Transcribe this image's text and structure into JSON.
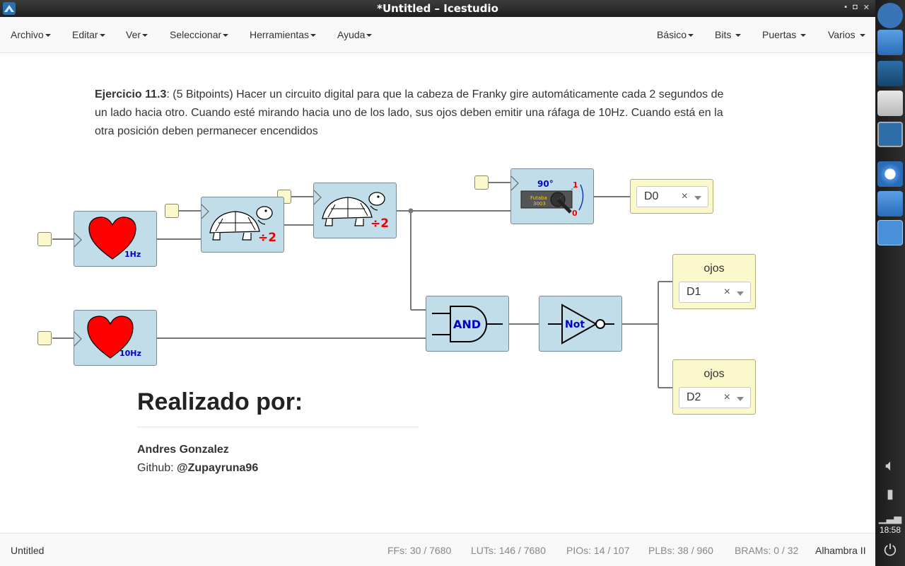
{
  "window": {
    "title": "*Untitled – Icestudio"
  },
  "menus_left": [
    "Archivo",
    "Editar",
    "Ver",
    "Seleccionar",
    "Herramientas",
    "Ayuda"
  ],
  "menus_right": [
    "Básico",
    "Bits",
    "Puertas",
    "Varios"
  ],
  "exercise": {
    "bold": "Ejercicio 11.3",
    "text": ": (5 Bitpoints) Hacer un circuito digital para que la cabeza de Franky gire automáticamente cada 2 segundos de un lado hacia otro. Cuando esté mirando hacia uno de los lado, sus ojos deben emitir una ráfaga de 10Hz. Cuando está en la otra posición deben permanecer encendidos"
  },
  "blocks": {
    "heart1": {
      "label": "1Hz"
    },
    "heart2": {
      "label": "10Hz"
    },
    "div1": {
      "label": "÷2"
    },
    "div2": {
      "label": "÷2"
    },
    "servo": {
      "angle": "90°",
      "brand": "Futaba",
      "model": "3003",
      "one": "1",
      "zero": "0"
    },
    "and": {
      "label": "AND"
    },
    "not": {
      "label": "Not"
    }
  },
  "outputs": {
    "d0": {
      "value": "D0",
      "clear": "×"
    },
    "d1": {
      "name": "ojos",
      "value": "D1",
      "clear": "×"
    },
    "d2": {
      "name": "ojos",
      "value": "D2",
      "clear": "×"
    }
  },
  "credits": {
    "heading": "Realizado por:",
    "author": "Andres Gonzalez",
    "github_label": "Github: ",
    "github_handle": "@Zupayruna96"
  },
  "status": {
    "file": "Untitled",
    "ffs_label": "FFs:",
    "ffs": "30 / 7680",
    "luts_label": "LUTs:",
    "luts": "146 / 7680",
    "pios_label": "PIOs:",
    "pios": "14 / 107",
    "plbs_label": "PLBs:",
    "plbs": "38 / 960",
    "brams_label": "BRAMs:",
    "brams": "0 / 32",
    "board": "Alhambra II"
  },
  "dock": {
    "clock": "18:58"
  },
  "colors": {
    "block_fill": "#c1dde9",
    "port_fill": "#fbf8cc",
    "heart": "#ff0000",
    "label_blue": "#0000cc"
  }
}
